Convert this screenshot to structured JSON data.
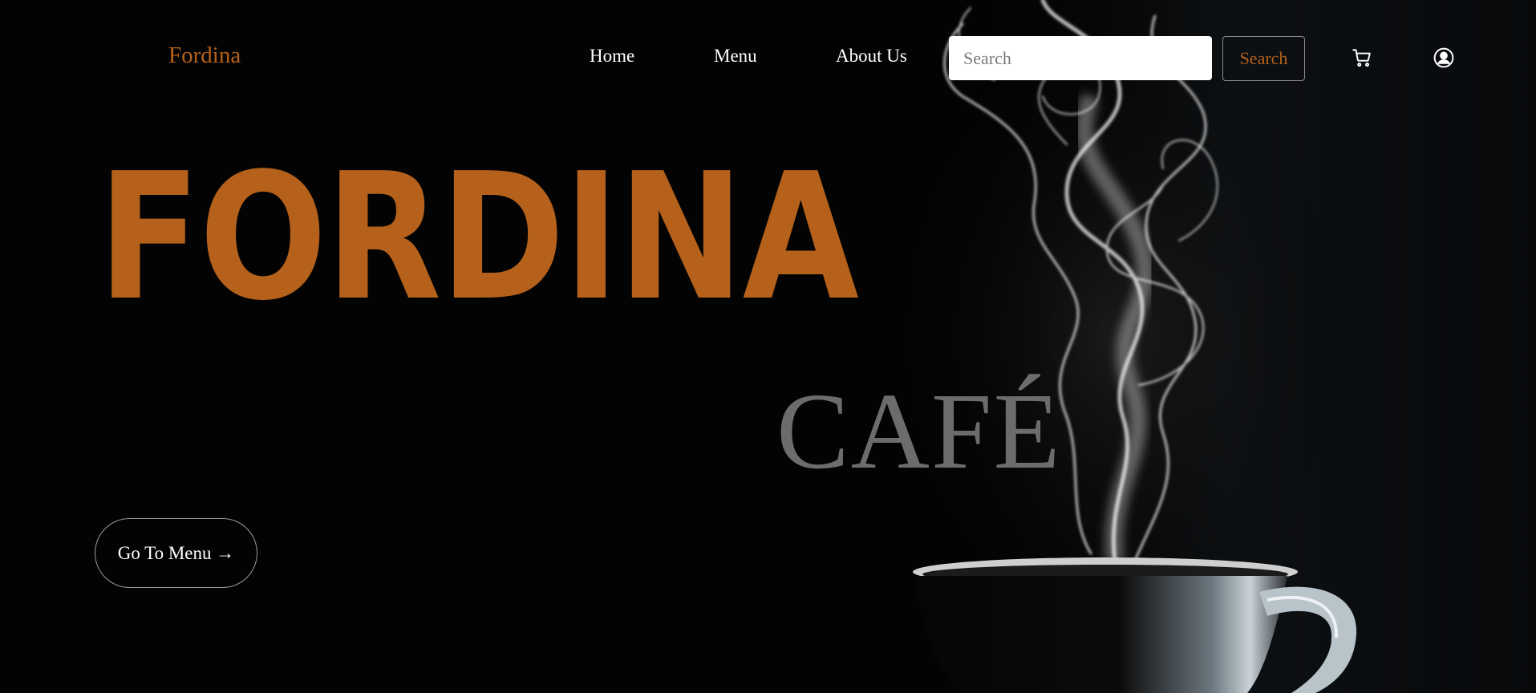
{
  "nav": {
    "brand": "Fordina",
    "links": [
      {
        "label": "Home"
      },
      {
        "label": "Menu"
      },
      {
        "label": "About Us"
      }
    ],
    "search": {
      "placeholder": "Search",
      "value": "",
      "button_label": "Search"
    },
    "icons": {
      "cart": "cart-icon",
      "account": "user-circle-icon"
    }
  },
  "hero": {
    "title": "FORDINA",
    "subtitle": "CAFÉ",
    "cta_label": "Go To Menu →",
    "image": "steaming coffee cup with smoke on black background"
  },
  "colors": {
    "accent": "#b5611b",
    "background": "#030303",
    "text": "#ffffff",
    "subtitle": "#6c6c6c"
  }
}
